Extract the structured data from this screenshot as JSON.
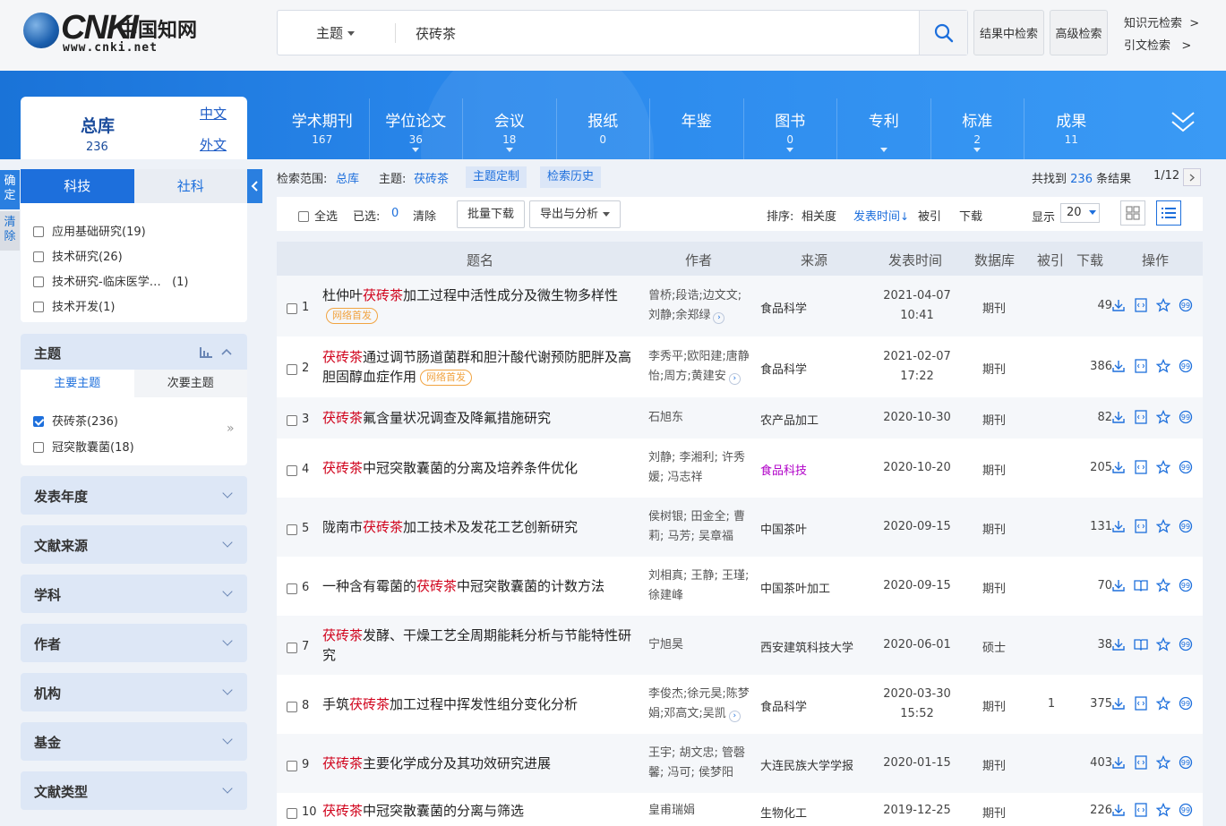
{
  "brand": {
    "cn": "中国知网",
    "url": "www.cnki.net"
  },
  "search": {
    "field": "主题",
    "query": "茯砖茶"
  },
  "top_buttons": {
    "in_results": "结果中检索",
    "advanced": "高级检索",
    "knowledge": "知识元检索",
    "citation": "引文检索",
    "arrow": ">"
  },
  "zongku": {
    "title": "总库",
    "count": "236",
    "zh": "中文",
    "en": "外文"
  },
  "db_tabs": [
    {
      "name": "学术期刊",
      "count": "167"
    },
    {
      "name": "学位论文",
      "count": "36"
    },
    {
      "name": "会议",
      "count": "18"
    },
    {
      "name": "报纸",
      "count": "0"
    },
    {
      "name": "年鉴",
      "count": ""
    },
    {
      "name": "图书",
      "count": "0"
    },
    {
      "name": "专利",
      "count": ""
    },
    {
      "name": "标准",
      "count": "2"
    },
    {
      "name": "成果",
      "count": "11"
    }
  ],
  "side_actions": {
    "confirm": "确定",
    "clear": "清除"
  },
  "category_tabs": {
    "tech": "科技",
    "social": "社科"
  },
  "category_items": [
    "应用基础研究(19)",
    "技术研究(26)",
    "技术研究-临床医学…   (1)",
    "技术开发(1)"
  ],
  "topic_panel": {
    "title": "主题",
    "main": "主要主题",
    "sub": "次要主题",
    "items": [
      "茯砖茶(236)",
      "冠突散囊菌(18)"
    ],
    "more": "»"
  },
  "facets": [
    "发表年度",
    "文献来源",
    "学科",
    "作者",
    "机构",
    "基金",
    "文献类型"
  ],
  "scope": {
    "label": "检索范围:",
    "value": "总库",
    "topic_label": "主题:",
    "topic_value": "茯砖茶",
    "custom": "主题定制",
    "history": "检索历史",
    "found_pre": "共找到",
    "found_num": "236",
    "found_post": "条结果",
    "page": "1/12"
  },
  "toolbar": {
    "select_all": "全选",
    "selected": "已选:",
    "selected_count": "0",
    "clear": "清除",
    "batch": "批量下载",
    "export": "导出与分析",
    "sort_label": "排序:",
    "sort_relevance": "相关度",
    "sort_time": "发表时间",
    "sort_cited": "被引",
    "sort_download": "下载",
    "show_label": "显示",
    "page_size": "20"
  },
  "table": {
    "headers": {
      "title": "题名",
      "author": "作者",
      "source": "来源",
      "date": "发表时间",
      "db": "数据库",
      "cited": "被引",
      "download": "下载",
      "ops": "操作"
    },
    "badge": "网络首发",
    "rows": [
      {
        "no": "1",
        "pre": "杜仲叶",
        "hl": "茯砖茶",
        "post": "加工过程中活性成分及微生物多样性",
        "badge": true,
        "authors": "曾桥;段诰;边文文;刘静;余郑绿",
        "more": true,
        "source": "食品科学",
        "date1": "2021-04-07",
        "date2": "10:41",
        "db": "期刊",
        "cited": "",
        "dl": "49"
      },
      {
        "no": "2",
        "pre": "",
        "hl": "茯砖茶",
        "post": "通过调节肠道菌群和胆汁酸代谢预防肥胖及高胆固醇血症作用",
        "badge": true,
        "authors": "李秀平;欧阳建;唐静怡;周方;黄建安",
        "more": true,
        "source": "食品科学",
        "date1": "2021-02-07",
        "date2": "17:22",
        "db": "期刊",
        "cited": "",
        "dl": "386"
      },
      {
        "no": "3",
        "pre": "",
        "hl": "茯砖茶",
        "post": "氟含量状况调查及降氟措施研究",
        "badge": false,
        "authors": "石旭东",
        "more": false,
        "source": "农产品加工",
        "date1": "2020-10-30",
        "date2": "",
        "db": "期刊",
        "cited": "",
        "dl": "82"
      },
      {
        "no": "4",
        "pre": "",
        "hl": "茯砖茶",
        "post": "中冠突散囊菌的分离及培养条件优化",
        "badge": false,
        "authors": "刘静; 李湘利; 许秀媛; 冯志祥",
        "more": false,
        "source": "食品科技",
        "pink": true,
        "date1": "2020-10-20",
        "date2": "",
        "db": "期刊",
        "cited": "",
        "dl": "205"
      },
      {
        "no": "5",
        "pre": "陇南市",
        "hl": "茯砖茶",
        "post": "加工技术及发花工艺创新研究",
        "badge": false,
        "authors": "侯树银; 田金全; 曹莉; 马芳; 吴章福",
        "more": false,
        "source": "中国茶叶",
        "date1": "2020-09-15",
        "date2": "",
        "db": "期刊",
        "cited": "",
        "dl": "131"
      },
      {
        "no": "6",
        "pre": "一种含有霉菌的",
        "hl": "茯砖茶",
        "post": "中冠突散囊菌的计数方法",
        "badge": false,
        "authors": "刘相真; 王静; 王瑾; 徐建峰",
        "more": false,
        "source": "中国茶叶加工",
        "date1": "2020-09-15",
        "date2": "",
        "db": "期刊",
        "cited": "",
        "dl": "70"
      },
      {
        "no": "7",
        "pre": "",
        "hl": "茯砖茶",
        "post": "发酵、干燥工艺全周期能耗分析与节能特性研究",
        "badge": false,
        "authors": "宁旭昊",
        "more": false,
        "source": "西安建筑科技大学",
        "date1": "2020-06-01",
        "date2": "",
        "db": "硕士",
        "cited": "",
        "dl": "38"
      },
      {
        "no": "8",
        "pre": "手筑",
        "hl": "茯砖茶",
        "post": "加工过程中挥发性组分变化分析",
        "badge": false,
        "authors": "李俊杰;徐元昊;陈梦娟;邓高文;吴凯",
        "more": true,
        "source": "食品科学",
        "date1": "2020-03-30",
        "date2": "15:52",
        "db": "期刊",
        "cited": "1",
        "dl": "375"
      },
      {
        "no": "9",
        "pre": "",
        "hl": "茯砖茶",
        "post": "主要化学成分及其功效研究进展",
        "badge": false,
        "authors": "王宇; 胡文忠; 管磬馨; 冯可; 侯梦阳",
        "more": false,
        "source": "大连民族大学学报",
        "date1": "2020-01-15",
        "date2": "",
        "db": "期刊",
        "cited": "",
        "dl": "403"
      },
      {
        "no": "10",
        "pre": "",
        "hl": "茯砖茶",
        "post": "中冠突散囊菌的分离与筛选",
        "badge": false,
        "authors": "皇甫瑞娟",
        "more": false,
        "source": "生物化工",
        "date1": "2019-12-25",
        "date2": "",
        "db": "期刊",
        "cited": "",
        "dl": "226"
      }
    ]
  },
  "colors": {
    "brand_blue": "#1d6fdc",
    "highlight_red": "#d0021b",
    "badge_orange": "#f1a442"
  }
}
